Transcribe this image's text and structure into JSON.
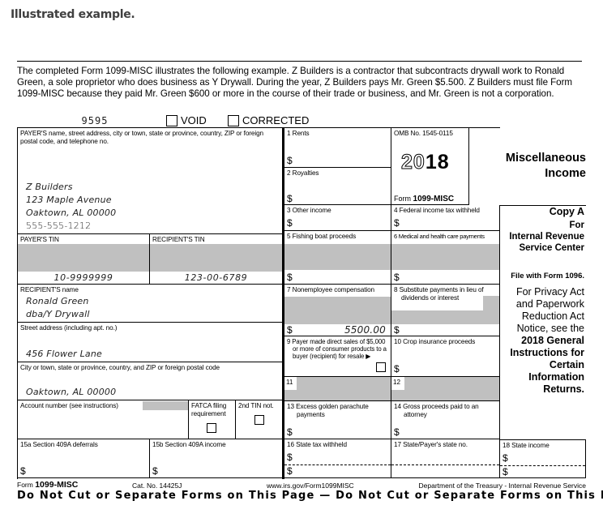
{
  "page": {
    "heading": "Illustrated example.",
    "intro": "The completed Form 1099-MISC illustrates the following example. Z Builders is a contractor that subcontracts drywall work to Ronald Green, a sole proprietor who does business as Y Drywall. During the year, Z Builders pays Mr. Green $5.500. Z Builders must file Form 1099-MISC because they paid Mr. Green $600 or more in the course of their trade or business, and Mr. Green is not a corporation."
  },
  "form": {
    "control_number": "9595",
    "void_label": "VOID",
    "corrected_label": "CORRECTED",
    "void_checked": false,
    "corrected_checked": false,
    "payer_label": "PAYER'S name, street address, city or town, state or province, country, ZIP or foreign postal code, and telephone no.",
    "payer_lines": [
      "Z Builders",
      "123 Maple Avenue",
      "Oaktown, AL 00000",
      "555-555-1212"
    ],
    "payer_tin_label": "PAYER'S TIN",
    "recipient_tin_label": "RECIPIENT'S TIN",
    "payer_tin": "10-9999999",
    "recipient_tin": "123-00-6789",
    "recipient_name_label": "RECIPIENT'S name",
    "recipient_name_lines": [
      "Ronald Green",
      "dba/Y Drywall"
    ],
    "street_label": "Street address (including apt. no.)",
    "street_value": "456 Flower Lane",
    "city_label": "City or town, state or province, country, and ZIP or foreign postal code",
    "city_value": "Oaktown, AL 00000",
    "account_label": "Account number (see instructions)",
    "fatca_label": "FATCA filing requirement",
    "second_tin_label": "2nd TIN not.",
    "omb": "OMB No. 1545-0115",
    "year_outline": "20",
    "year_bold": "18",
    "form_word": "Form",
    "form_name": "1099-MISC",
    "title_line1": "Miscellaneous",
    "title_line2": "Income",
    "copy_a": "Copy A",
    "for": "For",
    "irs_line1": "Internal Revenue",
    "irs_line2": "Service Center",
    "file_with": "File with Form 1096.",
    "privacy_lines": [
      "For Privacy Act",
      "and Paperwork",
      "Reduction Act",
      "Notice, see the"
    ],
    "instr_lines": [
      "2018 General",
      "Instructions for",
      "Certain",
      "Information",
      "Returns."
    ],
    "currency": "$",
    "boxes": {
      "b1": "1 Rents",
      "b2": "2 Royalties",
      "b3": "3 Other income",
      "b4": "4 Federal income tax withheld",
      "b5": "5 Fishing boat proceeds",
      "b6": "6 Medical and health care payments",
      "b7": "7 Nonemployee compensation",
      "b7_value": "5500.00",
      "b8": "8 Substitute payments in lieu of dividends or interest",
      "b9": "9 Payer made direct sales of $5,000 or more of consumer products to a buyer (recipient) for resale ▶",
      "b10": "10 Crop insurance proceeds",
      "b11": "11",
      "b12": "12",
      "b13": "13 Excess golden parachute payments",
      "b14": "14 Gross proceeds paid to an attorney",
      "b15a": "15a Section 409A deferrals",
      "b15b": "15b Section 409A income",
      "b16": "16 State tax withheld",
      "b17": "17 State/Payer's state no.",
      "b18": "18 State income"
    }
  },
  "footer": {
    "form_word": "Form",
    "form_name": "1099-MISC",
    "cat_no": "Cat. No. 14425J",
    "url": "www.irs.gov/Form1099MISC",
    "dept": "Department of the Treasury - Internal Revenue Service",
    "do_not_cut": "Do Not Cut or Separate Forms on This Page — Do Not Cut or Separate Forms on This Page"
  }
}
